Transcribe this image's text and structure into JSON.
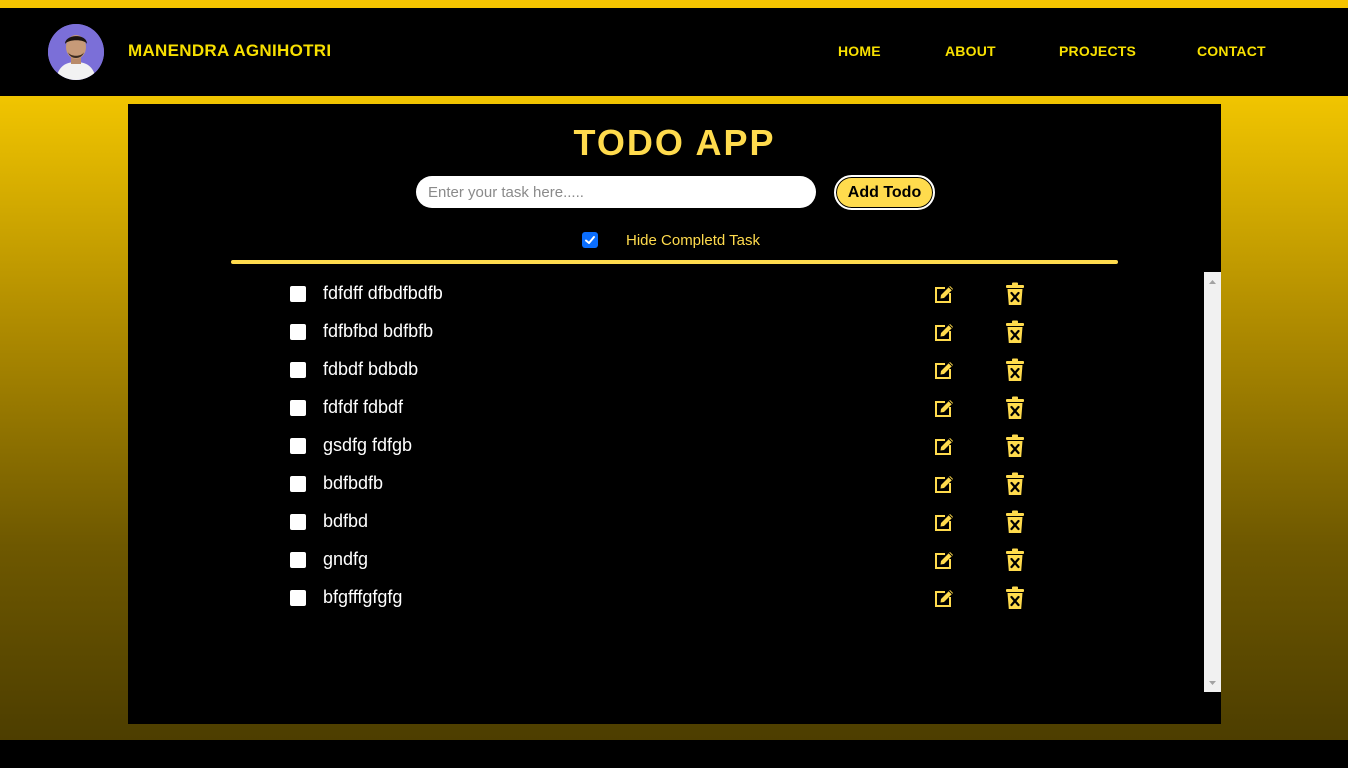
{
  "brand": {
    "name": "MANENDRA AGNIHOTRI",
    "accent": "#f8e000"
  },
  "nav": [
    {
      "label": "HOME"
    },
    {
      "label": "ABOUT"
    },
    {
      "label": "PROJECTS"
    },
    {
      "label": "CONTACT"
    }
  ],
  "app": {
    "title": "TODO APP",
    "input_placeholder": "Enter your task here.....",
    "input_value": "",
    "add_label": "Add Todo",
    "hide_completed_label": "Hide Completd Task",
    "hide_completed_checked": true
  },
  "todos": [
    {
      "text": "fdfdff dfbdfbdfb",
      "done": false
    },
    {
      "text": "fdfbfbd bdfbfb",
      "done": false
    },
    {
      "text": "fdbdf bdbdb",
      "done": false
    },
    {
      "text": "fdfdf fdbdf",
      "done": false
    },
    {
      "text": "gsdfg fdfgb",
      "done": false
    },
    {
      "text": "bdfbdfb",
      "done": false
    },
    {
      "text": "bdfbd",
      "done": false
    },
    {
      "text": "gndfg",
      "done": false
    },
    {
      "text": "bfgfffgfgfg",
      "done": false
    }
  ],
  "icons": {
    "edit": "edit-icon",
    "delete": "trash-x-icon",
    "check": "check-icon"
  },
  "colors": {
    "yellow": "#ffdb4d",
    "checkbox_blue": "#0b6efd"
  }
}
